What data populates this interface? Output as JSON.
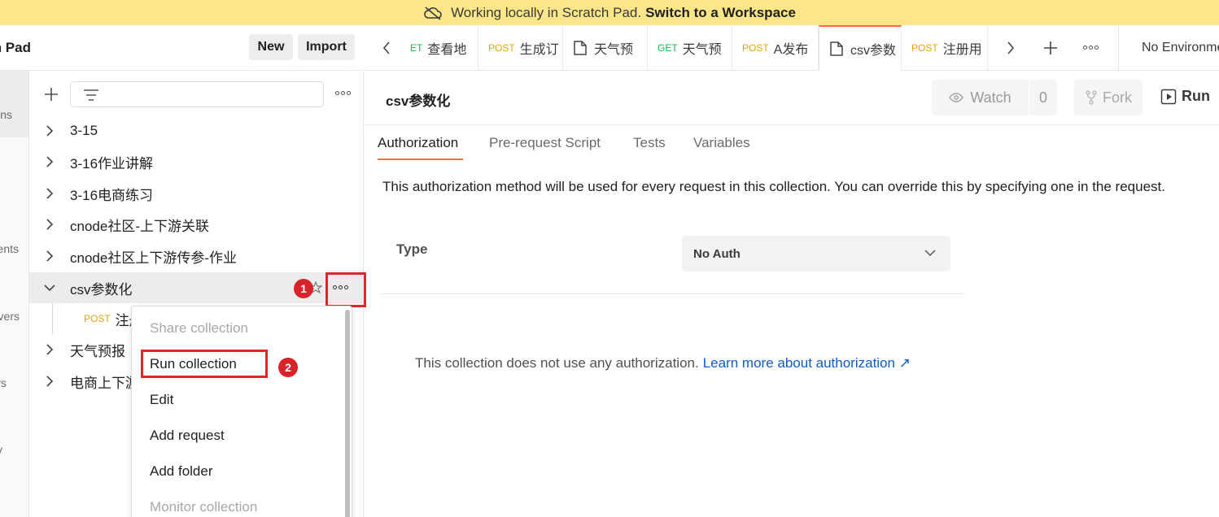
{
  "banner": {
    "text": "Working locally in Scratch Pad.",
    "link": "Switch to a Workspace",
    "icon": "cloud-off-icon"
  },
  "rail": {
    "labels": [
      "ns",
      "ents",
      "vers",
      "rs",
      "y"
    ]
  },
  "sidebar": {
    "workspace_name": "n Pad",
    "new_label": "New",
    "import_label": "Import",
    "tree": [
      {
        "label": "3-15"
      },
      {
        "label": "3-16作业讲解"
      },
      {
        "label": "3-16电商练习"
      },
      {
        "label": "cnode社区-上下游关联"
      },
      {
        "label": "cnode社区上下游传参-作业"
      },
      {
        "label": "csv参数化"
      },
      {
        "label": "天气预报"
      },
      {
        "label": "电商上下游"
      }
    ],
    "sub_item": {
      "method": "POST",
      "label": "注册"
    }
  },
  "context_menu": {
    "items": [
      {
        "label": "Share collection",
        "disabled": true
      },
      {
        "label": "Run collection",
        "disabled": false
      },
      {
        "label": "Edit",
        "disabled": false
      },
      {
        "label": "Add request",
        "disabled": false
      },
      {
        "label": "Add folder",
        "disabled": false
      },
      {
        "label": "Monitor collection",
        "disabled": true
      }
    ]
  },
  "annotations": {
    "badge1": "1",
    "badge2": "2",
    "color": "#e0262d"
  },
  "tabs": [
    {
      "method": "ET",
      "label": "查看地",
      "type": "request"
    },
    {
      "method": "POST",
      "label": "生成订",
      "type": "request"
    },
    {
      "method": "",
      "label": "天气预",
      "type": "collection"
    },
    {
      "method": "GET",
      "label": "天气预",
      "type": "request"
    },
    {
      "method": "POST",
      "label": "A发布",
      "type": "request"
    },
    {
      "method": "",
      "label": "csv参数",
      "type": "collection",
      "active": true
    },
    {
      "method": "POST",
      "label": "注册用",
      "type": "request"
    }
  ],
  "environment": "No Environment",
  "main": {
    "title": "csv参数化",
    "watch_label": "Watch",
    "watch_count": "0",
    "fork_label": "Fork",
    "run_label": "Run",
    "subtabs": [
      "Authorization",
      "Pre-request Script",
      "Tests",
      "Variables"
    ],
    "description": "This authorization method will be used for every request in this collection. You can override this by specifying one in the request.",
    "type_label": "Type",
    "auth_type": "No Auth",
    "no_auth_text": "This collection does not use any authorization.",
    "learn_more": "Learn more about authorization ↗"
  },
  "colors": {
    "accent": "#ff6c37",
    "banner": "#fce68a",
    "post": "#e8a10d",
    "get": "#0cbb52",
    "link": "#0f5cc4"
  }
}
